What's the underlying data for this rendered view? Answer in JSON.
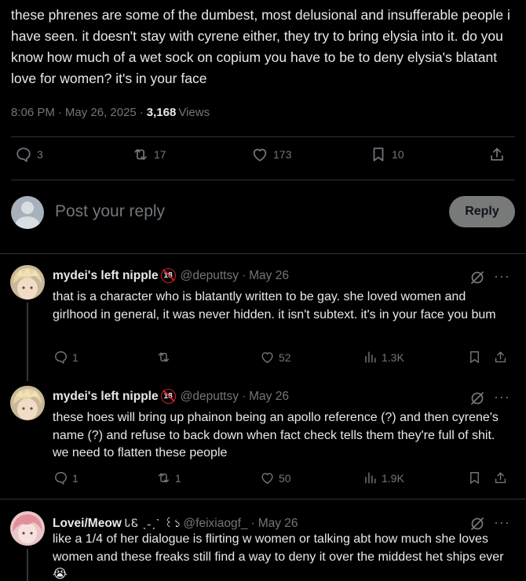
{
  "post": {
    "text": "these phrenes are some of the dumbest, most delusional and insufferable people i have seen. it doesn't stay with cyrene either, they try to bring elysia into it. do you know how much of a wet sock on copium you have to be to deny elysia's blatant love for women? it's in your face",
    "time": "8:06 PM",
    "separator": "·",
    "date": "May 26, 2025",
    "views_count": "3,168",
    "views_label": "Views",
    "stats": {
      "replies": "3",
      "reposts": "17",
      "likes": "173",
      "bookmarks": "10"
    }
  },
  "composer": {
    "placeholder": "Post your reply",
    "reply_label": "Reply"
  },
  "replies": [
    {
      "name": "mydei's left nipple",
      "badge": "18",
      "handle": "@deputtsy",
      "date": "May 26",
      "text": "that is a character who is blatantly written to be gay. she loved women and girlhood in general, it was never hidden. it isn't subtext. it's in your face you bum",
      "replies": "1",
      "reposts": "",
      "likes": "52",
      "views": "1.3K"
    },
    {
      "name": "mydei's left nipple",
      "badge": "18",
      "handle": "@deputtsy",
      "date": "May 26",
      "text": "these hoes will bring up phainon being an apollo reference (?) and then cyrene's name (?) and refuse to back down when fact check tells them they're full of shit. we need to flatten these people",
      "replies": "1",
      "reposts": "1",
      "likes": "50",
      "views": "1.9K"
    },
    {
      "name": "Lovei/Meow",
      "deco": "ᏓᏋ ˎ˗ˏˋ ꒰১ ",
      "handle": "@feixiaogf_",
      "date": "May 26",
      "text": "like a 1/4 of her dialogue is flirting w women or talking abt how much she loves women and these freaks still find a way to deny it over the middest het ships ever 😭"
    }
  ],
  "separator": "·",
  "colors": {
    "background": "#000000",
    "text": "#e7e9ea",
    "muted": "#71767b",
    "divider": "#2f3336",
    "reply_button": "#787a7a",
    "badge_red": "#d0222e"
  }
}
